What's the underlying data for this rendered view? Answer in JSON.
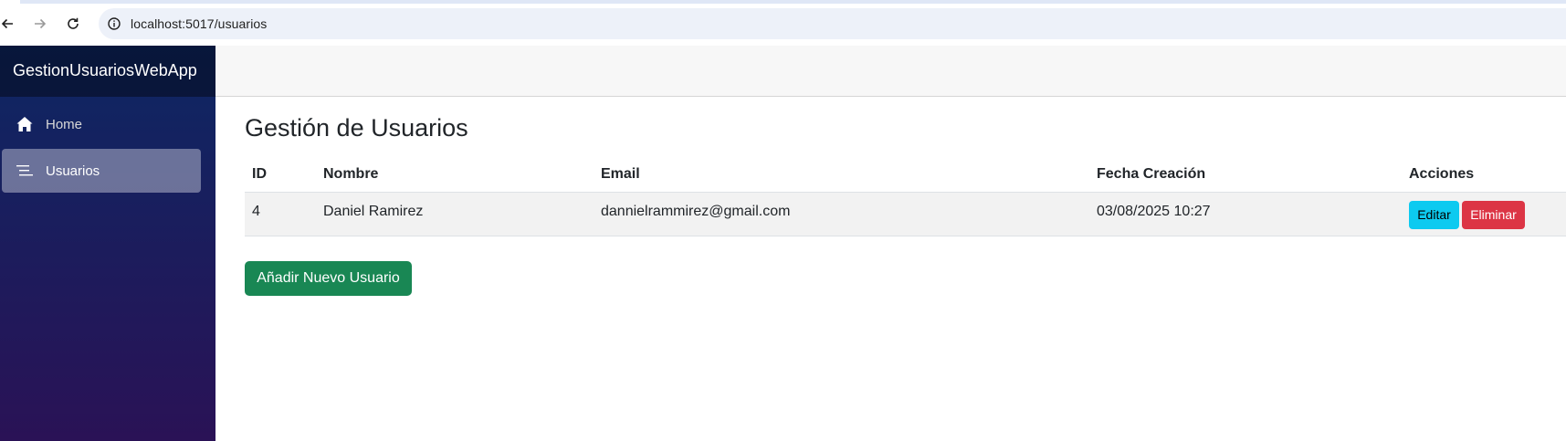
{
  "browser": {
    "url": "localhost:5017/usuarios",
    "icons": [
      "back-arrow-icon",
      "forward-arrow-icon",
      "reload-icon",
      "site-info-icon"
    ]
  },
  "sidebar": {
    "brand": "GestionUsuariosWebApp",
    "items": [
      {
        "label": "Home",
        "icon": "house-icon",
        "active": false
      },
      {
        "label": "Usuarios",
        "icon": "list-icon",
        "active": true
      }
    ]
  },
  "main": {
    "title": "Gestión de Usuarios",
    "table": {
      "columns": [
        "ID",
        "Nombre",
        "Email",
        "Fecha Creación",
        "Acciones"
      ],
      "rows": [
        {
          "id": "4",
          "nombre": "Daniel Ramirez",
          "email": "dannielrammirez@gmail.com",
          "fecha": "03/08/2025 10:27",
          "edit_label": "Editar",
          "delete_label": "Eliminar"
        }
      ]
    },
    "add_button": "Añadir Nuevo Usuario"
  },
  "colors": {
    "sidebar_top": "#0d2763",
    "sidebar_bottom": "#2a1256",
    "edit_button": "#0dcaf0",
    "delete_button": "#dc3545",
    "add_button": "#198754"
  }
}
